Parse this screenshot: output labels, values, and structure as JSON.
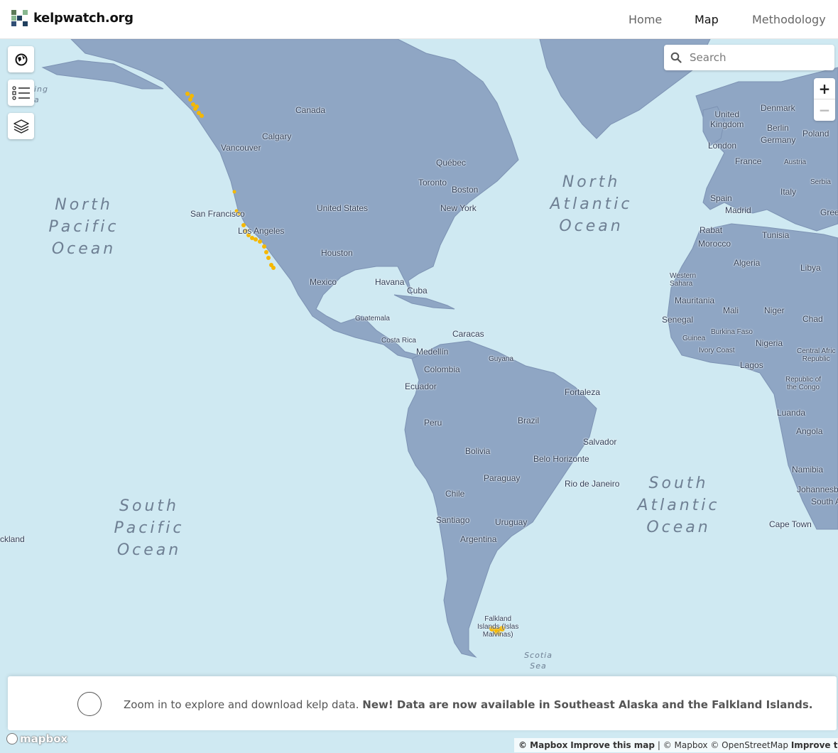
{
  "brand": {
    "name": "kelpwatch.org",
    "colors": [
      "#5b7a56",
      "#21405e",
      "#88b890",
      "#314f75"
    ]
  },
  "nav": {
    "home": "Home",
    "map": "Map",
    "methodology": "Methodology"
  },
  "map_controls": {
    "globe_icon": "globe-icon",
    "legend_icon": "legend-list-icon",
    "layers_icon": "layers-icon",
    "search_placeholder": "Search",
    "zoom_in": "+",
    "zoom_out": "−"
  },
  "oceans": {
    "north_pacific": "North\nPacific\nOcean",
    "north_atlantic": "North\nAtlantic\nOcean",
    "south_pacific": "South\nPacific\nOcean",
    "south_atlantic": "South\nAtlantic\nOcean",
    "scotia_sea": "Scotia\nSea",
    "bering_sea_partial": "ing\na"
  },
  "places": {
    "canada": "Canada",
    "calgary": "Calgary",
    "vancouver": "Vancouver",
    "san_francisco": "San Francisco",
    "los_angeles": "Los Angeles",
    "united_states": "United States",
    "quebec": "Québec",
    "toronto": "Toronto",
    "boston": "Boston",
    "new_york": "New York",
    "houston": "Houston",
    "mexico": "Mexico",
    "havana": "Havana",
    "cuba": "Cuba",
    "guatemala": "Guatemala",
    "costa_rica": "Costa Rica",
    "caracas": "Caracas",
    "medellin": "Medellín",
    "colombia": "Colombia",
    "guyana": "Guyana",
    "ecuador": "Ecuador",
    "fortaleza": "Fortaleza",
    "peru": "Peru",
    "brazil": "Brazil",
    "bolivia": "Bolivia",
    "salvador": "Salvador",
    "belo_horizonte": "Belo Horizonte",
    "paraguay": "Paraguay",
    "rio": "Rio de Janeiro",
    "chile": "Chile",
    "santiago": "Santiago",
    "uruguay": "Uruguay",
    "argentina": "Argentina",
    "falkland": "Falkland\nIslands (Islas\nMalvinas)",
    "auckland": "ckland",
    "united_kingdom": "United\nKingdom",
    "denmark": "Denmark",
    "berlin": "Berlin",
    "germany": "Germany",
    "poland": "Poland",
    "london": "London",
    "france": "France",
    "austria": "Austria",
    "serbia": "Serbia",
    "spain": "Spain",
    "madrid": "Madrid",
    "italy": "Italy",
    "greece": "Gree",
    "rabat": "Rabat",
    "morocco": "Morocco",
    "tunisia": "Tunisia",
    "algeria": "Algeria",
    "libya": "Libya",
    "western_sahara": "Western\nSahara",
    "mauritania": "Mauritania",
    "mali": "Mali",
    "niger": "Niger",
    "chad": "Chad",
    "senegal": "Senegal",
    "burkina": "Burkina Faso",
    "guinea": "Guinea",
    "ivory": "Ivory Coast",
    "nigeria": "Nigeria",
    "car": "Central Afric\nRepublic",
    "lagos": "Lagos",
    "congo": "Republic of\nthe Congo",
    "luanda": "Luanda",
    "angola": "Angola",
    "namibia": "Namibia",
    "johannesburg": "Johannesbu",
    "south_africa": "South A",
    "cape_town": "Cape Town"
  },
  "banner": {
    "text": "Zoom in to explore and download kelp data. ",
    "bold": "New! Data are now available in Southeast Alaska and the Falkland Islands."
  },
  "attribution": {
    "mapbox_logo": "mapbox",
    "mapbox1": "© Mapbox",
    "improve1": "Improve this map",
    "sep": "|",
    "mapbox2": "© Mapbox",
    "osm": "© OpenStreetMap",
    "improve2": "Improve this map"
  },
  "colors": {
    "water": "#cfe9f2",
    "land": "#8fa6c4",
    "kelp": "#f5b800"
  }
}
